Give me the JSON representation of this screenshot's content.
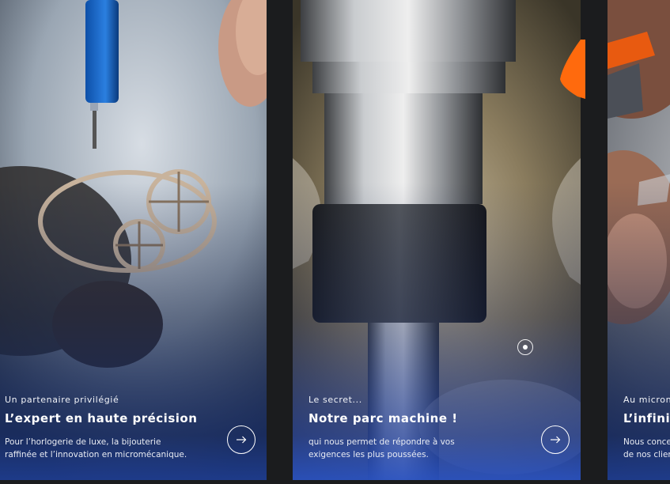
{
  "slider": {
    "cards": [
      {
        "eyebrow": "Un partenaire privilégié",
        "title": "L’expert en haute précision",
        "description": "Pour l’horlogerie de luxe, la bijouterie raffinée et l’innovation en micromécanique.",
        "arrow_icon": "arrow-right-icon"
      },
      {
        "eyebrow": "Le secret...",
        "title": "Notre parc machine !",
        "description": "qui nous permet de répondre à vos exigences les plus poussées.",
        "arrow_icon": "arrow-right-icon",
        "hotspot_icon": "target-dot-icon"
      },
      {
        "eyebrow": "Au micron près",
        "title": "L’infiniment précis",
        "description": "Nous concevons des pièces qui répondent aux attentes de nos clients les plus exigeants, à l’infiniment petit."
      }
    ]
  },
  "colors": {
    "background": "#1b1c1e",
    "overlay_blue": "#1c3a8c",
    "text": "#ffffff"
  }
}
